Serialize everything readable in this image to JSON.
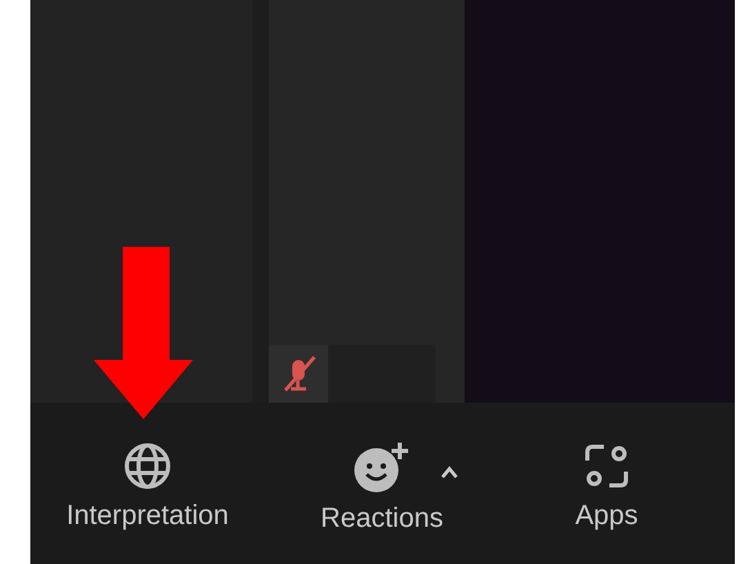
{
  "participant_tile": {
    "muted": true
  },
  "toolbar": {
    "items": [
      {
        "kind": "globe",
        "label": "Interpretation",
        "has_menu": false
      },
      {
        "kind": "reaction",
        "label": "Reactions",
        "has_menu": true
      },
      {
        "kind": "apps",
        "label": "Apps",
        "has_menu": false
      }
    ]
  }
}
